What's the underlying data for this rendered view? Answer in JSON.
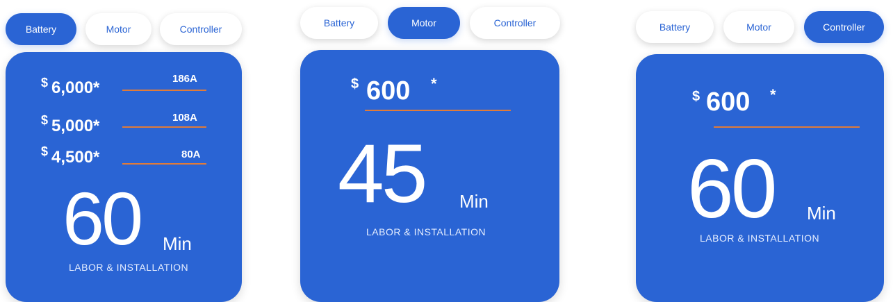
{
  "colors": {
    "brand_blue": "#2a64d4",
    "accent_orange": "#e07b39",
    "tab_bg": "#ffffff"
  },
  "panels": [
    {
      "tabs": [
        "Battery",
        "Motor",
        "Controller"
      ],
      "active_tab": "Battery",
      "prices": [
        {
          "symbol": "$",
          "amount": "6,000*",
          "amperage": "186A"
        },
        {
          "symbol": "$",
          "amount": "5,000*",
          "amperage": "108A"
        },
        {
          "symbol": "$",
          "amount": "4,500*",
          "amperage": "80A"
        }
      ],
      "time_value": "60",
      "time_unit": "Min",
      "label": "LABOR & INSTALLATION"
    },
    {
      "tabs": [
        "Battery",
        "Motor",
        "Controller"
      ],
      "active_tab": "Motor",
      "price": {
        "symbol": "$",
        "amount": "600",
        "asterisk": "*"
      },
      "time_value": "45",
      "time_unit": "Min",
      "label": "LABOR & INSTALLATION"
    },
    {
      "tabs": [
        "Battery",
        "Motor",
        "Controller"
      ],
      "active_tab": "Controller",
      "price": {
        "symbol": "$",
        "amount": "600",
        "asterisk": "*"
      },
      "time_value": "60",
      "time_unit": "Min",
      "label": "LABOR & INSTALLATION"
    }
  ]
}
